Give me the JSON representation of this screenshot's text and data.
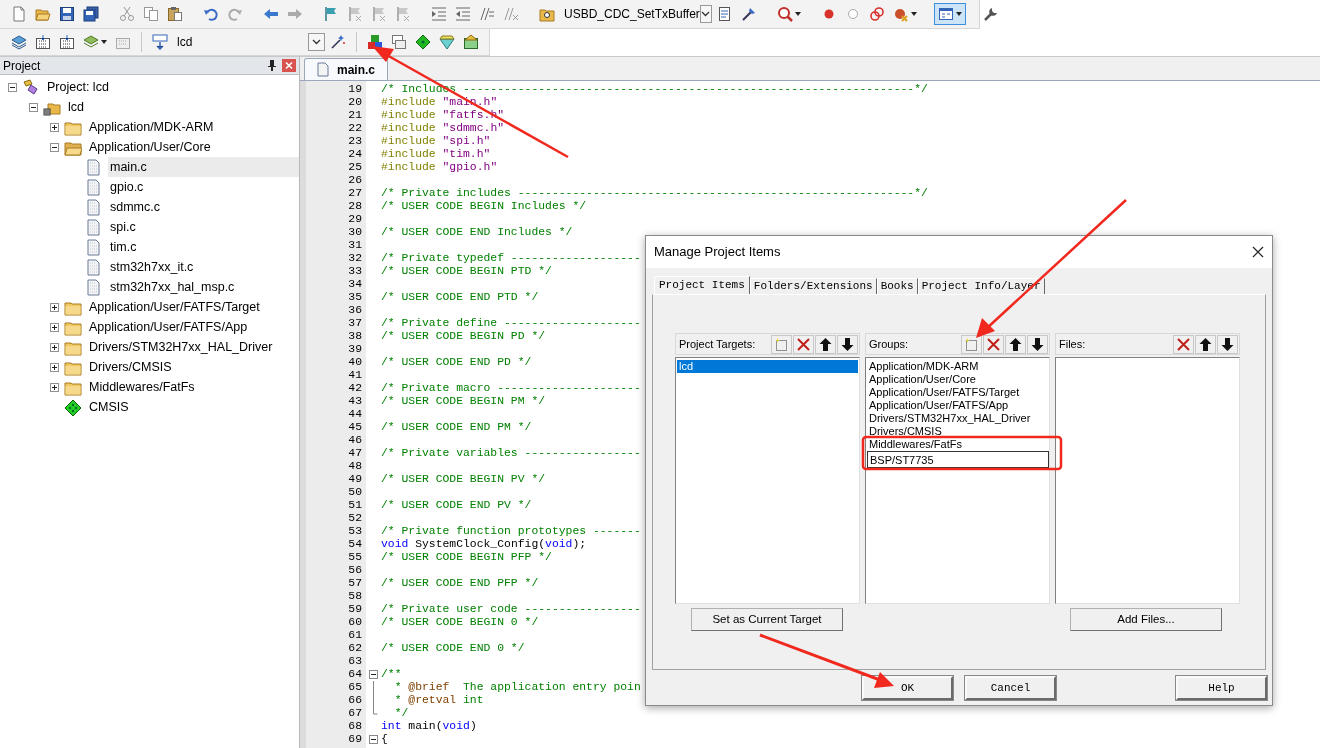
{
  "toolbar": {
    "function_combo": {
      "value": "USBD_CDC_SetTxBuffer"
    },
    "target_combo": {
      "value": "lcd"
    }
  },
  "project_panel": {
    "title": "Project",
    "tree": [
      {
        "label": "Project: lcd",
        "kind": "project",
        "expanded": true,
        "selected": false,
        "children": [
          {
            "label": "lcd",
            "kind": "target",
            "expanded": true,
            "selected": false,
            "children": [
              {
                "label": "Application/MDK-ARM",
                "kind": "folder",
                "expanded": false,
                "selected": false
              },
              {
                "label": "Application/User/Core",
                "kind": "folder",
                "expanded": true,
                "selected": false,
                "children": [
                  {
                    "label": "main.c",
                    "kind": "file",
                    "selected": true
                  },
                  {
                    "label": "gpio.c",
                    "kind": "file",
                    "selected": false
                  },
                  {
                    "label": "sdmmc.c",
                    "kind": "file",
                    "selected": false
                  },
                  {
                    "label": "spi.c",
                    "kind": "file",
                    "selected": false
                  },
                  {
                    "label": "tim.c",
                    "kind": "file",
                    "selected": false
                  },
                  {
                    "label": "stm32h7xx_it.c",
                    "kind": "file",
                    "selected": false
                  },
                  {
                    "label": "stm32h7xx_hal_msp.c",
                    "kind": "file",
                    "selected": false
                  }
                ]
              },
              {
                "label": "Application/User/FATFS/Target",
                "kind": "folder",
                "expanded": false,
                "selected": false
              },
              {
                "label": "Application/User/FATFS/App",
                "kind": "folder",
                "expanded": false,
                "selected": false
              },
              {
                "label": "Drivers/STM32H7xx_HAL_Driver",
                "kind": "folder",
                "expanded": false,
                "selected": false
              },
              {
                "label": "Drivers/CMSIS",
                "kind": "folder",
                "expanded": false,
                "selected": false
              },
              {
                "label": "Middlewares/FatFs",
                "kind": "folder",
                "expanded": false,
                "selected": false
              },
              {
                "label": "CMSIS",
                "kind": "component",
                "selected": false
              }
            ]
          }
        ]
      }
    ]
  },
  "editor": {
    "tabs": [
      {
        "label": "main.c",
        "selected": true
      }
    ],
    "lines": [
      {
        "number": "19",
        "segments": [
          {
            "kind": "comment",
            "text": "/* Includes ------------------------------------------------------------------*/"
          }
        ]
      },
      {
        "number": "20",
        "segments": [
          {
            "kind": "preproc",
            "text": "#include "
          },
          {
            "kind": "string",
            "text": "\"main.h\""
          }
        ]
      },
      {
        "number": "21",
        "segments": [
          {
            "kind": "preproc",
            "text": "#include "
          },
          {
            "kind": "string",
            "text": "\"fatfs.h\""
          }
        ]
      },
      {
        "number": "22",
        "segments": [
          {
            "kind": "preproc",
            "text": "#include "
          },
          {
            "kind": "string",
            "text": "\"sdmmc.h\""
          }
        ]
      },
      {
        "number": "23",
        "segments": [
          {
            "kind": "preproc",
            "text": "#include "
          },
          {
            "kind": "string",
            "text": "\"spi.h\""
          }
        ]
      },
      {
        "number": "24",
        "segments": [
          {
            "kind": "preproc",
            "text": "#include "
          },
          {
            "kind": "string",
            "text": "\"tim.h\""
          }
        ]
      },
      {
        "number": "25",
        "segments": [
          {
            "kind": "preproc",
            "text": "#include "
          },
          {
            "kind": "string",
            "text": "\"gpio.h\""
          }
        ]
      },
      {
        "number": "26"
      },
      {
        "number": "27",
        "segments": [
          {
            "kind": "comment",
            "text": "/* Private includes ----------------------------------------------------------*/"
          }
        ]
      },
      {
        "number": "28",
        "segments": [
          {
            "kind": "comment",
            "text": "/* USER CODE BEGIN Includes */"
          }
        ]
      },
      {
        "number": "29"
      },
      {
        "number": "30",
        "segments": [
          {
            "kind": "comment",
            "text": "/* USER CODE END Includes */"
          }
        ]
      },
      {
        "number": "31"
      },
      {
        "number": "32",
        "segments": [
          {
            "kind": "comment",
            "text": "/* Private typedef -------------------"
          }
        ]
      },
      {
        "number": "33",
        "segments": [
          {
            "kind": "comment",
            "text": "/* USER CODE BEGIN PTD */"
          }
        ]
      },
      {
        "number": "34"
      },
      {
        "number": "35",
        "segments": [
          {
            "kind": "comment",
            "text": "/* USER CODE END PTD */"
          }
        ]
      },
      {
        "number": "36"
      },
      {
        "number": "37",
        "segments": [
          {
            "kind": "comment",
            "text": "/* Private define --------------------"
          }
        ]
      },
      {
        "number": "38",
        "segments": [
          {
            "kind": "comment",
            "text": "/* USER CODE BEGIN PD */"
          }
        ]
      },
      {
        "number": "39"
      },
      {
        "number": "40",
        "segments": [
          {
            "kind": "comment",
            "text": "/* USER CODE END PD */"
          }
        ]
      },
      {
        "number": "41"
      },
      {
        "number": "42",
        "segments": [
          {
            "kind": "comment",
            "text": "/* Private macro ---------------------"
          }
        ]
      },
      {
        "number": "43",
        "segments": [
          {
            "kind": "comment",
            "text": "/* USER CODE BEGIN PM */"
          }
        ]
      },
      {
        "number": "44"
      },
      {
        "number": "45",
        "segments": [
          {
            "kind": "comment",
            "text": "/* USER CODE END PM */"
          }
        ]
      },
      {
        "number": "46"
      },
      {
        "number": "47",
        "segments": [
          {
            "kind": "comment",
            "text": "/* Private variables -----------------"
          }
        ]
      },
      {
        "number": "48"
      },
      {
        "number": "49",
        "segments": [
          {
            "kind": "comment",
            "text": "/* USER CODE BEGIN PV */"
          }
        ]
      },
      {
        "number": "50"
      },
      {
        "number": "51",
        "segments": [
          {
            "kind": "comment",
            "text": "/* USER CODE END PV */"
          }
        ]
      },
      {
        "number": "52"
      },
      {
        "number": "53",
        "segments": [
          {
            "kind": "comment",
            "text": "/* Private function prototypes -------"
          }
        ]
      },
      {
        "number": "54",
        "segments": [
          {
            "kind": "keyword",
            "text": "void"
          },
          {
            "kind": "plain",
            "text": " SystemClock_Config("
          },
          {
            "kind": "keyword",
            "text": "void"
          },
          {
            "kind": "plain",
            "text": ");"
          }
        ]
      },
      {
        "number": "55",
        "segments": [
          {
            "kind": "comment",
            "text": "/* USER CODE BEGIN PFP */"
          }
        ]
      },
      {
        "number": "56"
      },
      {
        "number": "57",
        "segments": [
          {
            "kind": "comment",
            "text": "/* USER CODE END PFP */"
          }
        ]
      },
      {
        "number": "58"
      },
      {
        "number": "59",
        "segments": [
          {
            "kind": "comment",
            "text": "/* Private user code -----------------"
          }
        ]
      },
      {
        "number": "60",
        "segments": [
          {
            "kind": "comment",
            "text": "/* USER CODE BEGIN 0 */"
          }
        ]
      },
      {
        "number": "61"
      },
      {
        "number": "62",
        "segments": [
          {
            "kind": "comment",
            "text": "/* USER CODE END 0 */"
          }
        ]
      },
      {
        "number": "63"
      },
      {
        "number": "64",
        "kind": "fold_start",
        "segments": [
          {
            "kind": "comment",
            "text": "/**"
          }
        ]
      },
      {
        "number": "65",
        "kind": "fold_body",
        "segments": [
          {
            "kind": "comment",
            "text": "  * "
          },
          {
            "kind": "doctag",
            "text": "@brief"
          },
          {
            "kind": "comment",
            "text": "  The application entry poin"
          }
        ]
      },
      {
        "number": "66",
        "kind": "fold_body",
        "segments": [
          {
            "kind": "comment",
            "text": "  * "
          },
          {
            "kind": "doctag",
            "text": "@retval"
          },
          {
            "kind": "comment",
            "text": " int"
          }
        ]
      },
      {
        "number": "67",
        "kind": "fold_end",
        "segments": [
          {
            "kind": "comment",
            "text": "  */"
          }
        ]
      },
      {
        "number": "68",
        "segments": [
          {
            "kind": "keyword",
            "text": "int"
          },
          {
            "kind": "plain",
            "text": " main("
          },
          {
            "kind": "keyword",
            "text": "void"
          },
          {
            "kind": "plain",
            "text": ")"
          }
        ]
      },
      {
        "number": "69",
        "kind": "fold_start",
        "segments": [
          {
            "kind": "plain",
            "text": "{"
          }
        ]
      }
    ]
  },
  "dialog": {
    "title": "Manage Project Items",
    "tabs": [
      {
        "label": "Project Items",
        "selected": true
      },
      {
        "label": "Folders/Extensions",
        "selected": false
      },
      {
        "label": "Books",
        "selected": false
      },
      {
        "label": "Project Info/Layer",
        "selected": false
      }
    ],
    "targets": {
      "label": "Project Targets:",
      "items": [
        {
          "label": "lcd",
          "selected": true
        }
      ],
      "button": "Set as Current Target"
    },
    "groups": {
      "label": "Groups:",
      "items": [
        {
          "label": "Application/MDK-ARM",
          "selected": false
        },
        {
          "label": "Application/User/Core",
          "selected": false
        },
        {
          "label": "Application/User/FATFS/Target",
          "selected": false
        },
        {
          "label": "Application/User/FATFS/App",
          "selected": false
        },
        {
          "label": "Drivers/STM32H7xx_HAL_Driver",
          "selected": false
        },
        {
          "label": "Drivers/CMSIS",
          "selected": false
        },
        {
          "label": "Middlewares/FatFs",
          "selected": false
        }
      ],
      "new_item": {
        "value": "BSP/ST7735"
      }
    },
    "files": {
      "label": "Files:",
      "button": "Add Files..."
    },
    "buttons": [
      "OK",
      "Cancel",
      "Help"
    ]
  }
}
